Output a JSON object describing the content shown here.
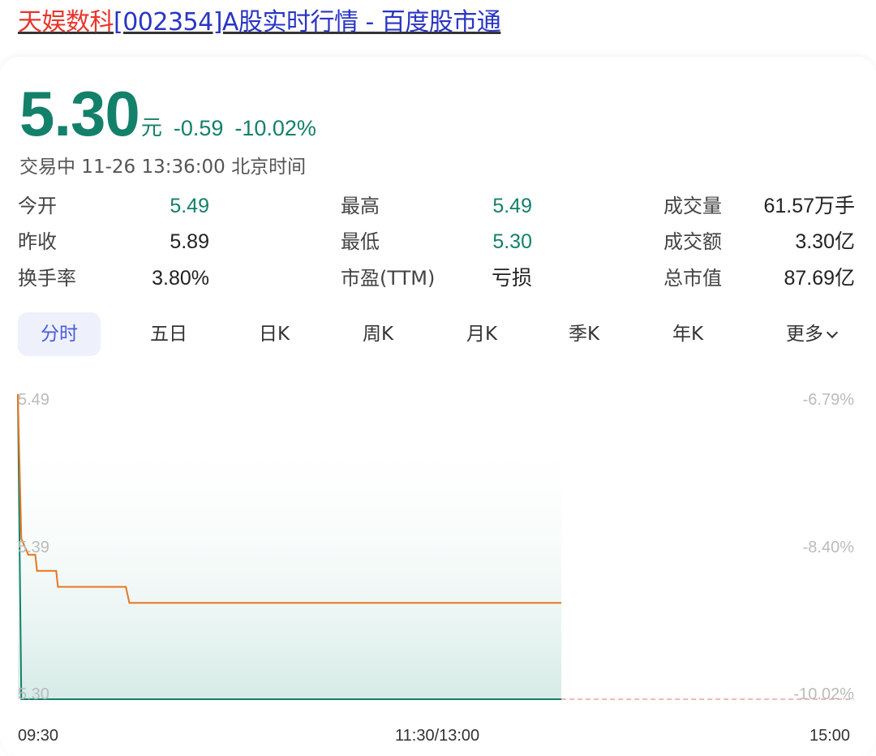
{
  "page": {
    "title_brand": "天娱数科",
    "title_rest": "[002354]A股实时行情 - 百度股市通"
  },
  "quote": {
    "price": "5.30",
    "unit": "元",
    "change": "-0.59",
    "change_pct": "-10.02%",
    "status": "交易中 11-26 13:36:00 北京时间"
  },
  "stats": [
    {
      "label": "今开",
      "value": "5.49",
      "color": "#13806a"
    },
    {
      "label": "最高",
      "value": "5.49",
      "color": "#13806a"
    },
    {
      "label": "成交量",
      "value": "61.57万手",
      "color": "#222222"
    },
    {
      "label": "昨收",
      "value": "5.89",
      "color": "#222222"
    },
    {
      "label": "最低",
      "value": "5.30",
      "color": "#13806a"
    },
    {
      "label": "成交额",
      "value": "3.30亿",
      "color": "#222222"
    },
    {
      "label": "换手率",
      "value": "3.80%",
      "color": "#222222"
    },
    {
      "label": "市盈(TTM)",
      "value": "亏损",
      "color": "#222222"
    },
    {
      "label": "总市值",
      "value": "87.69亿",
      "color": "#222222"
    }
  ],
  "tabs": [
    {
      "label": "分时",
      "active": true
    },
    {
      "label": "五日"
    },
    {
      "label": "日K"
    },
    {
      "label": "周K"
    },
    {
      "label": "月K"
    },
    {
      "label": "季K"
    },
    {
      "label": "年K"
    },
    {
      "label": "更多",
      "icon": "chevron-down-icon"
    }
  ],
  "chart_data": {
    "type": "line",
    "yticks_left": [
      "5.49",
      "5.39",
      "5.30"
    ],
    "yticks_right": [
      "-6.79%",
      "-8.40%",
      "-10.02%"
    ],
    "xticks": [
      "09:30",
      "11:30/13:00",
      "15:00"
    ],
    "ylim": [
      5.3,
      5.49
    ],
    "total_minutes": 240,
    "price_series": [
      {
        "x": 0,
        "y": 5.49
      },
      {
        "x": 1,
        "y": 5.4
      },
      {
        "x": 3,
        "y": 5.39
      },
      {
        "x": 5,
        "y": 5.39
      },
      {
        "x": 5.5,
        "y": 5.38
      },
      {
        "x": 11,
        "y": 5.38
      },
      {
        "x": 11.5,
        "y": 5.37
      },
      {
        "x": 31,
        "y": 5.37
      },
      {
        "x": 32,
        "y": 5.36
      },
      {
        "x": 156,
        "y": 5.36
      }
    ],
    "avg_series": [
      {
        "x": 0,
        "y": 5.49
      },
      {
        "x": 1,
        "y": 5.3
      },
      {
        "x": 156,
        "y": 5.3
      }
    ],
    "line_color": "#e8761f",
    "avg_color": "#13806a",
    "limit_line_color": "#f0a0a0",
    "grid": false
  }
}
